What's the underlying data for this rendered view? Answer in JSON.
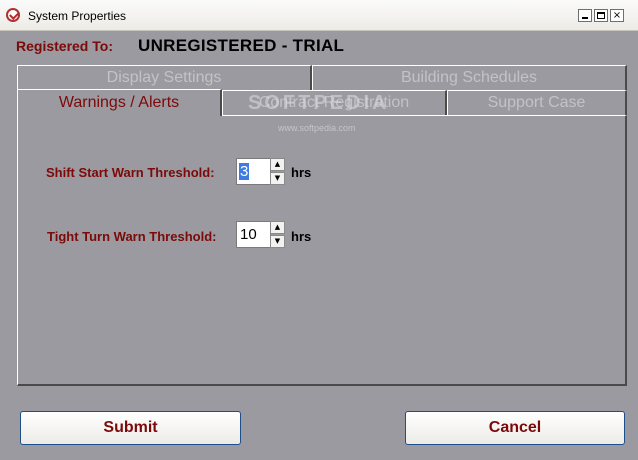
{
  "window": {
    "title": "System Properties",
    "controls": [
      "_",
      "□",
      "×"
    ]
  },
  "registration": {
    "label": "Registered To:",
    "value": "UNREGISTERED - TRIAL"
  },
  "tabs": {
    "display_settings": "Display Settings",
    "building_schedules": "Building Schedules",
    "warnings_alerts": "Warnings / Alerts",
    "contract_registration": "Contract Registration",
    "support_case": "Support Case",
    "active": "Warnings / Alerts"
  },
  "fields": {
    "shift_start": {
      "label": "Shift Start Warn Threshold:",
      "value": "3",
      "unit": "hrs"
    },
    "tight_turn": {
      "label": "Tight Turn Warn Threshold:",
      "value": "10",
      "unit": "hrs"
    }
  },
  "spinner": {
    "up": "▲",
    "down": "▼"
  },
  "buttons": {
    "submit": "Submit",
    "cancel": "Cancel"
  },
  "watermark": {
    "text": "SOFTPEDIA",
    "url": "www.softpedia.com"
  },
  "colors": {
    "label_red": "#7b0a0a",
    "background": "#9b9aa0",
    "button_border": "#1f4f8a"
  }
}
